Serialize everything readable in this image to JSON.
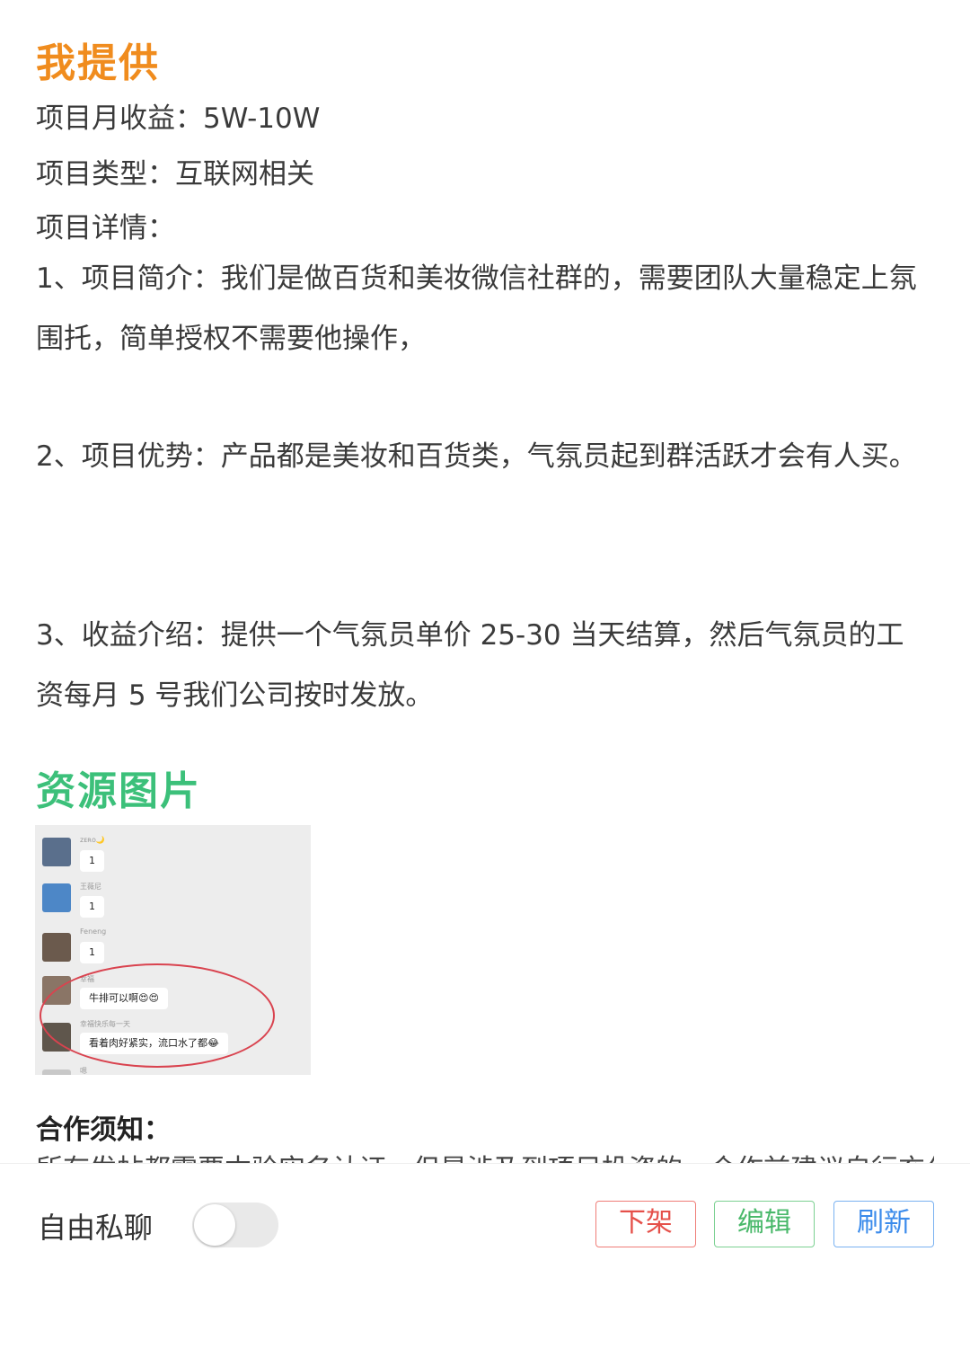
{
  "provide_section": {
    "title": "我提供",
    "monthly_income": "项目月收益：5W-10W",
    "project_type": "项目类型：互联网相关",
    "details_label": "项目详情：",
    "paragraphs": [
      "1、项目简介：我们是做百货和美妆微信社群的，需要团队大量稳定上氛围托，简单授权不需要他操作，",
      "2、项目优势：产品都是美妆和百货类，气氛员起到群活跃才会有人买。",
      "3、收益介绍：提供一个气氛员单价 25-30 当天结算，然后气氛员的工资每月 5 号我们公司按时发放。"
    ]
  },
  "resource_section": {
    "title": "资源图片",
    "chat_messages": [
      {
        "nickname": "ᴢᴇʀᴏ🌙",
        "text": "1"
      },
      {
        "nickname": "王薇尼",
        "text": "1"
      },
      {
        "nickname": "Feneng",
        "text": "1"
      },
      {
        "nickname": "幸福",
        "text": "牛排可以啊😍😍"
      },
      {
        "nickname": "幸福快乐每一天",
        "text": "看着肉好紧实，流口水了都😂"
      },
      {
        "nickname": "嗯",
        "text": ""
      }
    ]
  },
  "notice": {
    "title": "合作须知：",
    "text": "所有发帖都需要本验实名认证，但是涉及到项目投资的，合作前建议自行充分"
  },
  "bottom_bar": {
    "private_chat_label": "自由私聊",
    "toggle_on": false,
    "delist_label": "下架",
    "edit_label": "编辑",
    "refresh_label": "刷新"
  },
  "colors": {
    "orange_heading": "#f08c1e",
    "green_heading": "#3cc07a",
    "delist": "#e5504a",
    "edit": "#49b86a",
    "refresh": "#3b8beb"
  }
}
